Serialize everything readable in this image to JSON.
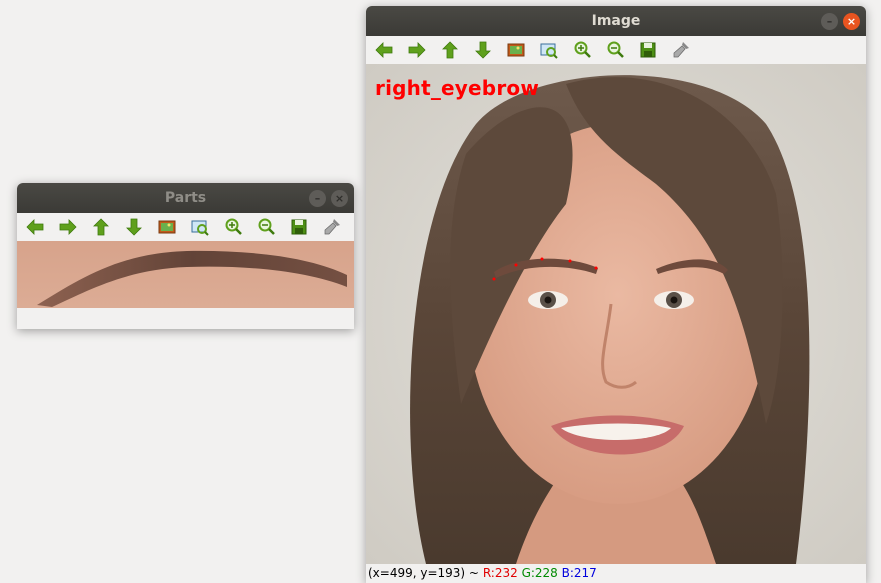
{
  "parts_window": {
    "title": "Parts",
    "toolbar": [
      "arrow-left-icon",
      "arrow-right-icon",
      "arrow-up-icon",
      "arrow-down-icon",
      "image-icon",
      "zoom-fit-icon",
      "zoom-in-icon",
      "zoom-out-icon",
      "save-icon",
      "properties-icon"
    ]
  },
  "image_window": {
    "title": "Image",
    "overlay_label": "right_eyebrow",
    "overlay_color": "#ff0000",
    "status": {
      "coords": "(x=499, y=193) ~",
      "r": "R:232",
      "g": "G:228",
      "b": "B:217"
    }
  },
  "colors": {
    "titlebar": "#3c3b37",
    "close_button": "#e95420",
    "toolbar_icon_green": "#5fa01c"
  }
}
